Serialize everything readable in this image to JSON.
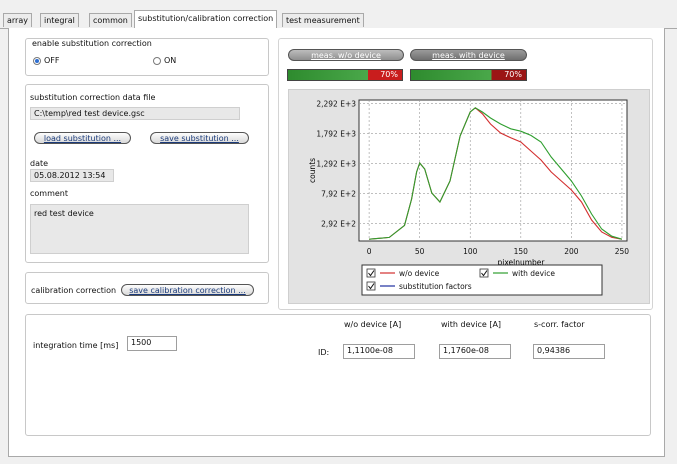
{
  "tabs": [
    {
      "label": "array",
      "active": false
    },
    {
      "label": "integral",
      "active": false
    },
    {
      "label": "common",
      "active": false
    },
    {
      "label": "substitution/calibration correction",
      "active": true
    },
    {
      "label": "test measurement",
      "active": false
    }
  ],
  "substitution": {
    "enable_label": "enable substitution correction",
    "off_label": "OFF",
    "on_label": "ON",
    "selected": "OFF",
    "data_file_label": "substitution correction data file",
    "data_file_value": "C:\\temp\\red test device.gsc",
    "load_button": "load substitution ...",
    "save_button": "save substitution ...",
    "date_label": "date",
    "date_value": "05.08.2012 13:54",
    "comment_label": "comment",
    "comment_value": "red test device"
  },
  "calibration": {
    "label": "calibration correction",
    "save_button": "save calibration correction ..."
  },
  "integration": {
    "label": "integration time [ms]",
    "value": "1500"
  },
  "measure": {
    "wo_button": "meas. w/o device",
    "with_button": "meas. with device",
    "wo_level_label": "70%",
    "with_level_label": "70%",
    "wo_level": 0.7,
    "with_level": 0.7
  },
  "results": {
    "wo_header": "w/o device [A]",
    "with_header": "with device [A]",
    "factor_header": "s-corr. factor",
    "row_label": "ID:",
    "wo_value": "1,1100e-08",
    "with_value": "1,1760e-08",
    "factor_value": "0,94386"
  },
  "chart_data": {
    "type": "line",
    "xlabel": "pixelnumber",
    "ylabel": "counts",
    "xlim": [
      -10,
      255
    ],
    "ylim": [
      0,
      2350
    ],
    "grid": true,
    "xticks": [
      "0",
      "50",
      "100",
      "150",
      "200",
      "250"
    ],
    "yticks": [
      "2,92 E+2",
      "7,92 E+2",
      "1,292 E+3",
      "1,792 E+3",
      "2,292 E+3"
    ],
    "legend": [
      "w/o device",
      "with device",
      "substitution factors"
    ],
    "legend_checked": [
      true,
      true,
      true
    ],
    "legend_position": "bottom",
    "colors": {
      "wo": "#d32f2f",
      "with": "#2e9e2e",
      "factors": "#1f2f9f"
    },
    "x": [
      0,
      20,
      35,
      42,
      47,
      50,
      55,
      62,
      70,
      80,
      90,
      100,
      105,
      112,
      120,
      130,
      140,
      150,
      160,
      170,
      180,
      190,
      200,
      210,
      220,
      230,
      240,
      250
    ],
    "series": [
      {
        "name": "w/o device",
        "values": [
          30,
          60,
          260,
          700,
          1150,
          1300,
          1200,
          800,
          650,
          1000,
          1750,
          2150,
          2220,
          2120,
          1950,
          1800,
          1720,
          1650,
          1500,
          1350,
          1150,
          1000,
          850,
          650,
          350,
          150,
          60,
          30
        ]
      },
      {
        "name": "with device",
        "values": [
          30,
          60,
          260,
          700,
          1150,
          1300,
          1200,
          800,
          650,
          1000,
          1750,
          2150,
          2220,
          2150,
          2050,
          1950,
          1870,
          1830,
          1760,
          1650,
          1400,
          1200,
          1000,
          750,
          450,
          200,
          80,
          30
        ]
      }
    ]
  }
}
